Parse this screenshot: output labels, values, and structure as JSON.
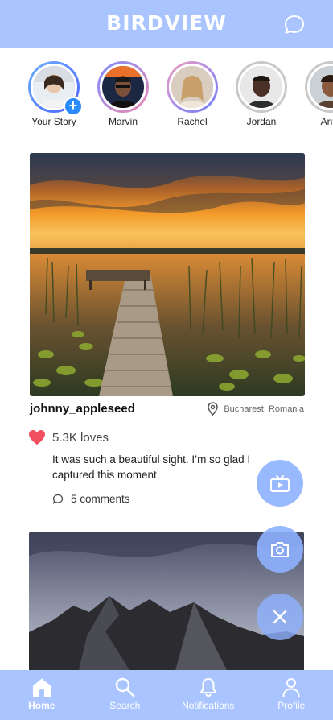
{
  "app": {
    "brand": "BIRDVIEW"
  },
  "header": {
    "chat_icon": "chat-bubble-icon"
  },
  "stories": [
    {
      "name": "Your Story",
      "has_add": true
    },
    {
      "name": "Marvin"
    },
    {
      "name": "Rachel"
    },
    {
      "name": "Jordan"
    },
    {
      "name": "Anto"
    }
  ],
  "post": {
    "username": "johnny_appleseed",
    "location": "Bucharest, Romania",
    "loves": "5.3K loves",
    "caption": "It was such a beautiful sight. I’m so glad I captured this moment.",
    "comments": "5 comments"
  },
  "fabs": {
    "tv_icon": "tv-icon",
    "camera_icon": "camera-icon",
    "close_icon": "close-icon"
  },
  "nav": {
    "items": [
      {
        "label": "Home",
        "icon": "home-icon",
        "active": true
      },
      {
        "label": "Search",
        "icon": "search-icon"
      },
      {
        "label": "Notifications",
        "icon": "bell-icon"
      },
      {
        "label": "Profile",
        "icon": "profile-icon"
      }
    ]
  },
  "colors": {
    "accent": "#a9c4ff",
    "fab": "#8eb1ff",
    "heart": "#f04f5f",
    "badge": "#2a8bff"
  }
}
